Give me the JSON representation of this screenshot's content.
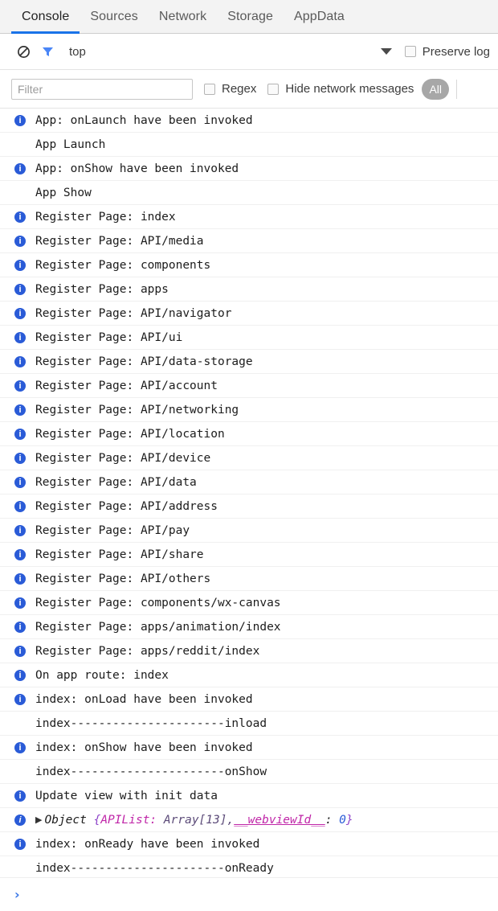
{
  "tabs": [
    {
      "label": "Console",
      "active": true
    },
    {
      "label": "Sources",
      "active": false
    },
    {
      "label": "Network",
      "active": false
    },
    {
      "label": "Storage",
      "active": false
    },
    {
      "label": "AppData",
      "active": false
    }
  ],
  "toolbar": {
    "clear_icon": "clear-console-icon",
    "filter_icon": "filter-funnel-icon",
    "context_label": "top",
    "context_caret": "chevron-down-icon",
    "preserve_log_label": "Preserve log",
    "preserve_log_checked": false
  },
  "filterbar": {
    "filter_placeholder": "Filter",
    "filter_value": "",
    "regex_label": "Regex",
    "regex_checked": false,
    "hide_network_label": "Hide network messages",
    "hide_network_checked": false,
    "level_pill": "All"
  },
  "colors": {
    "accent": "#1a73e8",
    "info_icon": "#2a5bd7",
    "pill_bg": "#a7a7a7",
    "tab_bar_bg": "#f3f3f3",
    "row_divider": "#f0f0f0",
    "token_key": "#c026a8",
    "token_brace": "#8e44c9",
    "token_value": "#5b4a78",
    "token_number": "#2a5bd7",
    "prompt_chevron": "#3b78e7"
  },
  "log_rows": [
    {
      "icon": true,
      "text": "App: onLaunch have been invoked"
    },
    {
      "icon": false,
      "text": "App Launch"
    },
    {
      "icon": true,
      "text": "App: onShow have been invoked"
    },
    {
      "icon": false,
      "text": "App Show"
    },
    {
      "icon": true,
      "text": "Register Page: index"
    },
    {
      "icon": true,
      "text": "Register Page: API/media"
    },
    {
      "icon": true,
      "text": "Register Page: components"
    },
    {
      "icon": true,
      "text": "Register Page: apps"
    },
    {
      "icon": true,
      "text": "Register Page: API/navigator"
    },
    {
      "icon": true,
      "text": "Register Page: API/ui"
    },
    {
      "icon": true,
      "text": "Register Page: API/data-storage"
    },
    {
      "icon": true,
      "text": "Register Page: API/account"
    },
    {
      "icon": true,
      "text": "Register Page: API/networking"
    },
    {
      "icon": true,
      "text": "Register Page: API/location"
    },
    {
      "icon": true,
      "text": "Register Page: API/device"
    },
    {
      "icon": true,
      "text": "Register Page: API/data"
    },
    {
      "icon": true,
      "text": "Register Page: API/address"
    },
    {
      "icon": true,
      "text": "Register Page: API/pay"
    },
    {
      "icon": true,
      "text": "Register Page: API/share"
    },
    {
      "icon": true,
      "text": "Register Page: API/others"
    },
    {
      "icon": true,
      "text": "Register Page: components/wx-canvas"
    },
    {
      "icon": true,
      "text": "Register Page: apps/animation/index"
    },
    {
      "icon": true,
      "text": "Register Page: apps/reddit/index"
    },
    {
      "icon": true,
      "text": "On app route: index"
    },
    {
      "icon": true,
      "text": "index: onLoad have been invoked"
    },
    {
      "icon": false,
      "text": "index----------------------inload"
    },
    {
      "icon": true,
      "text": "index: onShow have been invoked"
    },
    {
      "icon": false,
      "text": "index----------------------onShow"
    },
    {
      "icon": true,
      "text": "Update view with init data"
    }
  ],
  "object_row": {
    "disclosure": "triangle-right-icon",
    "label": "Object",
    "open_brace": " {",
    "key1": "APIList:",
    "value1": " Array[13],",
    "key2": "__webviewId__",
    "colon": ":",
    "value2": " 0",
    "close_brace": "}"
  },
  "log_rows_tail": [
    {
      "icon": true,
      "text": "index: onReady have been invoked"
    },
    {
      "icon": false,
      "text": "index----------------------onReady"
    }
  ],
  "prompt": {
    "chevron": "›",
    "value": "",
    "placeholder": ""
  }
}
